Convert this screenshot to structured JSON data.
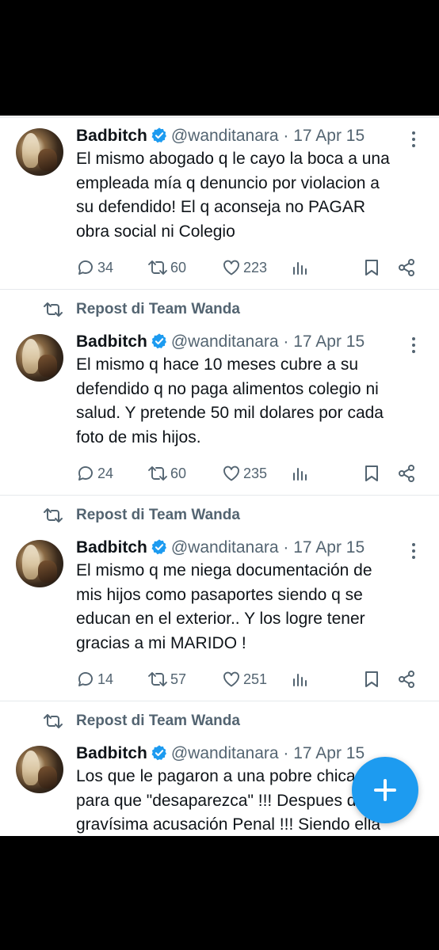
{
  "repost_label": "Repost di Team Wanda",
  "tweets": [
    {
      "name": "Badbitch",
      "handle": "@wanditanara",
      "date": "· 17 Apr 15",
      "text": "El mismo abogado q le cayo la boca a una\nempleada mía q denuncio por violacion a\nsu defendido! El q aconseja no PAGAR\nobra social ni Colegio",
      "replies": "34",
      "reposts": "60",
      "likes": "223"
    },
    {
      "name": "Badbitch",
      "handle": "@wanditanara",
      "date": "· 17 Apr 15",
      "text": "El mismo q hace 10 meses cubre a su\ndefendido q no paga alimentos colegio ni\nsalud. Y pretende 50 mil dolares por cada\nfoto de mis hijos.",
      "replies": "24",
      "reposts": "60",
      "likes": "235"
    },
    {
      "name": "Badbitch",
      "handle": "@wanditanara",
      "date": "· 17 Apr 15",
      "text": "El mismo q me niega documentación de\nmis hijos como pasaportes siendo q se\neducan en el exterior.. Y los logre tener\ngracias a mi MARIDO !",
      "replies": "14",
      "reposts": "57",
      "likes": "251"
    },
    {
      "name": "Badbitch",
      "handle": "@wanditanara",
      "date": "· 17 Apr 15",
      "text": "Los que le pagaron a una pobre chica\npara que \"desaparezca\" !!! Despues de la\ngravísima acusación Penal !!! Siendo ella"
    }
  ],
  "colors": {
    "accent": "#1d9bf0",
    "secondary_text": "#536471",
    "primary_text": "#0f1419"
  },
  "icons": [
    "verified-badge-icon",
    "more-icon",
    "reply-icon",
    "repost-icon",
    "like-icon",
    "views-icon",
    "bookmark-icon",
    "share-icon",
    "compose-plus-icon"
  ]
}
